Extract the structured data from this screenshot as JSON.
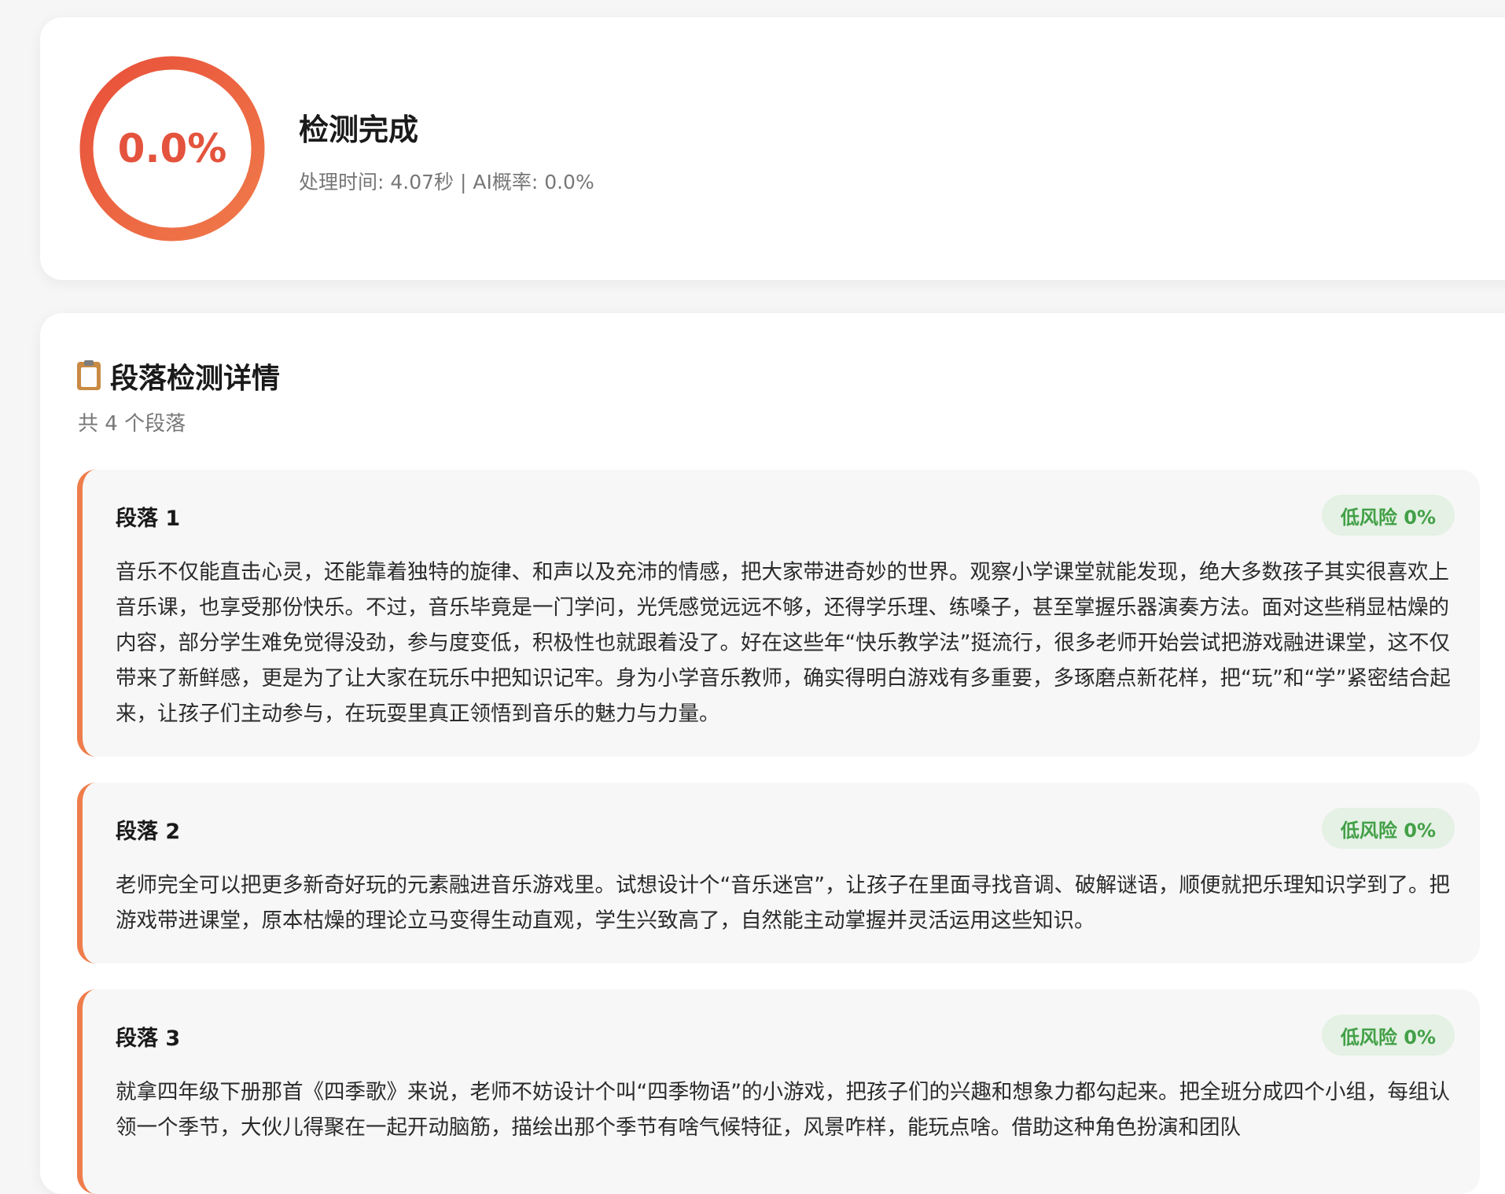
{
  "summary": {
    "score": "0.0%",
    "ai_probability": 0.0,
    "title": "检测完成",
    "meta": "处理时间: 4.07秒 | AI概率: 0.0%",
    "colors": {
      "ring_start": "#e8503a",
      "ring_end": "#f07a4a"
    }
  },
  "details": {
    "icon": "clipboard-icon",
    "title": "段落检测详情",
    "count": "共 4 个段落",
    "paragraphs": [
      {
        "label": "段落 1",
        "risk": "低风险 0%",
        "text": "音乐不仅能直击心灵，还能靠着独特的旋律、和声以及充沛的情感，把大家带进奇妙的世界。观察小学课堂就能发现，绝大多数孩子其实很喜欢上音乐课，也享受那份快乐。不过，音乐毕竟是一门学问，光凭感觉远远不够，还得学乐理、练嗓子，甚至掌握乐器演奏方法。面对这些稍显枯燥的内容，部分学生难免觉得没劲，参与度变低，积极性也就跟着没了。好在这些年“快乐教学法”挺流行，很多老师开始尝试把游戏融进课堂，这不仅带来了新鲜感，更是为了让大家在玩乐中把知识记牢。身为小学音乐教师，确实得明白游戏有多重要，多琢磨点新花样，把“玩”和“学”紧密结合起来，让孩子们主动参与，在玩耍里真正领悟到音乐的魅力与力量。"
      },
      {
        "label": "段落 2",
        "risk": "低风险 0%",
        "text": "老师完全可以把更多新奇好玩的元素融进音乐游戏里。试想设计个“音乐迷宫”，让孩子在里面寻找音调、破解谜语，顺便就把乐理知识学到了。把游戏带进课堂，原本枯燥的理论立马变得生动直观，学生兴致高了，自然能主动掌握并灵活运用这些知识。"
      },
      {
        "label": "段落 3",
        "risk": "低风险 0%",
        "text": "就拿四年级下册那首《四季歌》来说，老师不妨设计个叫“四季物语”的小游戏，把孩子们的兴趣和想象力都勾起来。把全班分成四个小组，每组认领一个季节，大伙儿得聚在一起开动脑筋，描绘出那个季节有啥气候特征，风景咋样，能玩点啥。借助这种角色扮演和团队"
      }
    ]
  }
}
